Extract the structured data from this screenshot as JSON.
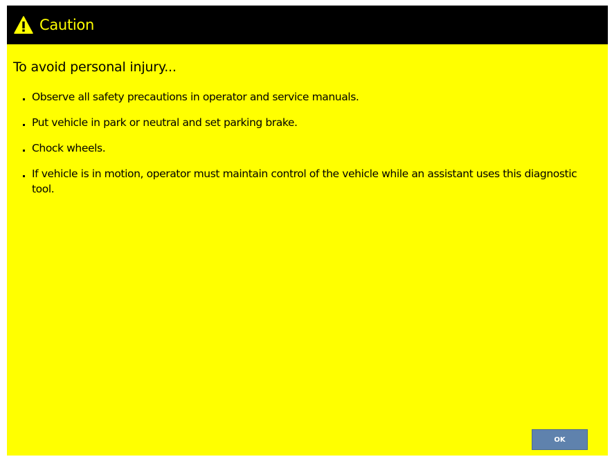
{
  "dialog": {
    "title": "Caution",
    "title_icon": "warning-triangle-icon",
    "heading": "To avoid personal injury...",
    "items": [
      "Observe all safety precautions in operator and service manuals.",
      "Put vehicle in park or neutral and set parking brake.",
      "Chock wheels.",
      "If vehicle is in motion, operator must maintain control of the vehicle while an assistant uses this diagnostic tool."
    ],
    "ok_label": "OK"
  },
  "colors": {
    "background": "#ffff00",
    "title_bar": "#000000",
    "title_text": "#ffff00",
    "button": "#5f82ad"
  }
}
